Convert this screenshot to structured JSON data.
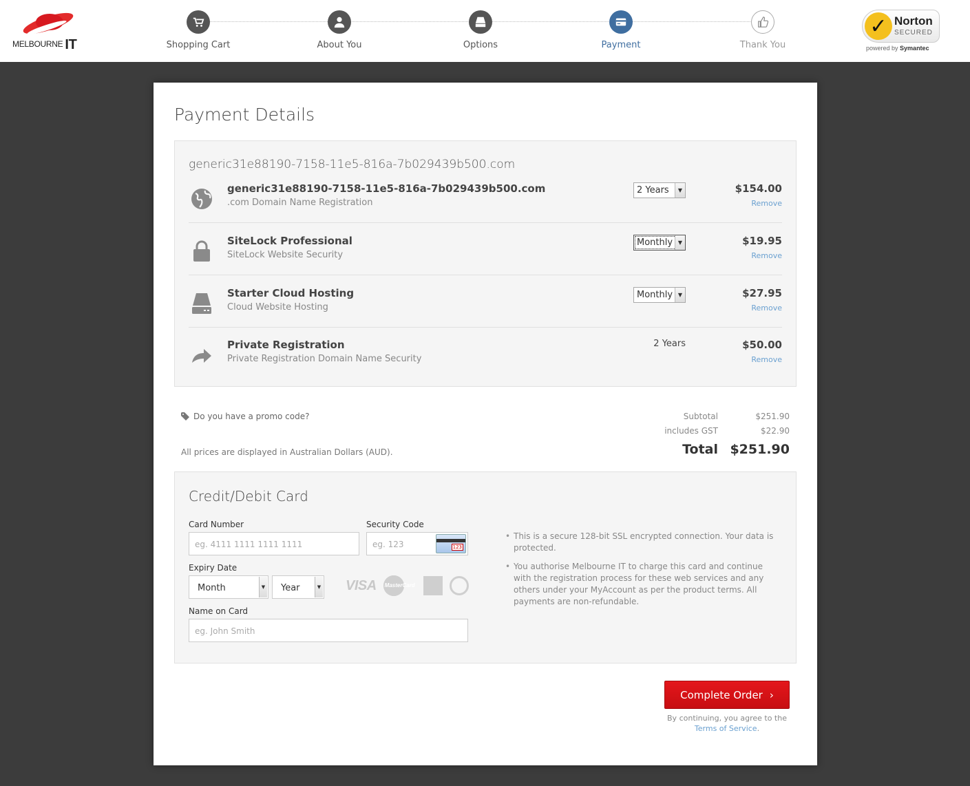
{
  "header": {
    "logo_text": "MELBOURNE",
    "logo_suffix": "IT",
    "steps": [
      {
        "label": "Shopping Cart",
        "icon": "cart-icon",
        "state": "done"
      },
      {
        "label": "About You",
        "icon": "user-icon",
        "state": "done"
      },
      {
        "label": "Options",
        "icon": "drive-icon",
        "state": "done"
      },
      {
        "label": "Payment",
        "icon": "credit-card-icon",
        "state": "active"
      },
      {
        "label": "Thank You",
        "icon": "thumbs-up-icon",
        "state": "future"
      }
    ],
    "norton": {
      "name": "Norton",
      "secured": "SECURED",
      "powered_prefix": "powered by",
      "powered_brand": "Symantec"
    }
  },
  "page_title": "Payment Details",
  "cart": {
    "domain_heading": "generic31e88190-7158-11e5-816a-7b029439b500.com",
    "items": [
      {
        "name": "generic31e88190-7158-11e5-816a-7b029439b500.com",
        "desc": ".com Domain Name Registration",
        "term": "2 Years",
        "term_type": "select",
        "price": "$154.00",
        "remove": "Remove",
        "icon": "globe-icon"
      },
      {
        "name": "SiteLock Professional",
        "desc": "SiteLock Website Security",
        "term": "Monthly",
        "term_type": "select",
        "price": "$19.95",
        "remove": "Remove",
        "icon": "lock-icon"
      },
      {
        "name": "Starter Cloud Hosting",
        "desc": "Cloud Website Hosting",
        "term": "Monthly",
        "term_type": "select",
        "price": "$27.95",
        "remove": "Remove",
        "icon": "hard-drive-icon"
      },
      {
        "name": "Private Registration",
        "desc": "Private Registration Domain Name Security",
        "term": "2 Years",
        "term_type": "text",
        "price": "$50.00",
        "remove": "Remove",
        "icon": "share-arrow-icon"
      }
    ]
  },
  "totals": {
    "promo": "Do you have a promo code?",
    "aud_note": "All prices are displayed in Australian Dollars (AUD).",
    "subtotal_label": "Subtotal",
    "subtotal": "$251.90",
    "gst_label": "includes GST",
    "gst": "$22.90",
    "total_label": "Total",
    "total": "$251.90"
  },
  "card": {
    "title": "Credit/Debit Card",
    "card_number_label": "Card Number",
    "card_number_placeholder": "eg. 4111 1111 1111 1111",
    "security_label": "Security Code",
    "security_placeholder": "eg. 123",
    "cvv_sample": "123",
    "expiry_label": "Expiry Date",
    "month": "Month",
    "year": "Year",
    "name_label": "Name on Card",
    "name_placeholder": "eg. John Smith",
    "brand_visa": "VISA",
    "brand_mastercard": "MasterCard",
    "notes": [
      "This is a secure 128-bit SSL encrypted connection. Your data is protected.",
      "You authorise Melbourne IT to charge this card and continue with the registration process for these web services and any others under your MyAccount as per the product terms. All payments are non-refundable."
    ]
  },
  "actions": {
    "complete_order": "Complete Order",
    "terms_prefix": "By continuing, you agree to the",
    "terms_link": "Terms of Service",
    "terms_suffix": "."
  },
  "colors": {
    "accent": "#3f6ea0",
    "button": "#e4161b",
    "background": "#3c3c3c"
  }
}
